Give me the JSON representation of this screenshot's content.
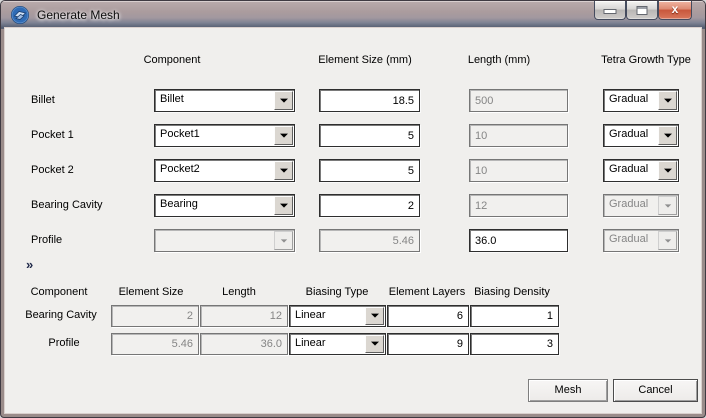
{
  "window": {
    "title": "Generate Mesh"
  },
  "form": {
    "headers": {
      "component": "Component",
      "element_size": "Element Size (mm)",
      "length": "Length (mm)",
      "growth": "Tetra Growth Type"
    },
    "rows": [
      {
        "label": "Billet",
        "component": "Billet",
        "element_size": "18.5",
        "length": "500",
        "growth": "Gradual"
      },
      {
        "label": "Pocket 1",
        "component": "Pocket1",
        "element_size": "5",
        "length": "10",
        "growth": "Gradual"
      },
      {
        "label": "Pocket 2",
        "component": "Pocket2",
        "element_size": "5",
        "length": "10",
        "growth": "Gradual"
      },
      {
        "label": "Bearing Cavity",
        "component": "Bearing",
        "element_size": "2",
        "length": "12",
        "growth": "Gradual"
      },
      {
        "label": "Profile",
        "component": "",
        "element_size": "5.46",
        "length": "36.0",
        "growth": "Gradual"
      }
    ]
  },
  "expander": {
    "glyph": "»"
  },
  "biasing": {
    "headers": {
      "component": "Component",
      "element_size": "Element Size",
      "length": "Length",
      "biasing_type": "Biasing Type",
      "element_layers": "Element Layers",
      "biasing_density": "Biasing Density"
    },
    "rows": [
      {
        "label": "Bearing Cavity",
        "element_size": "2",
        "length": "12",
        "biasing_type": "Linear",
        "element_layers": "6",
        "biasing_density": "1"
      },
      {
        "label": "Profile",
        "element_size": "5.46",
        "length": "36.0",
        "biasing_type": "Linear",
        "element_layers": "9",
        "biasing_density": "3"
      }
    ]
  },
  "footer": {
    "mesh": "Mesh",
    "cancel": "Cancel"
  }
}
